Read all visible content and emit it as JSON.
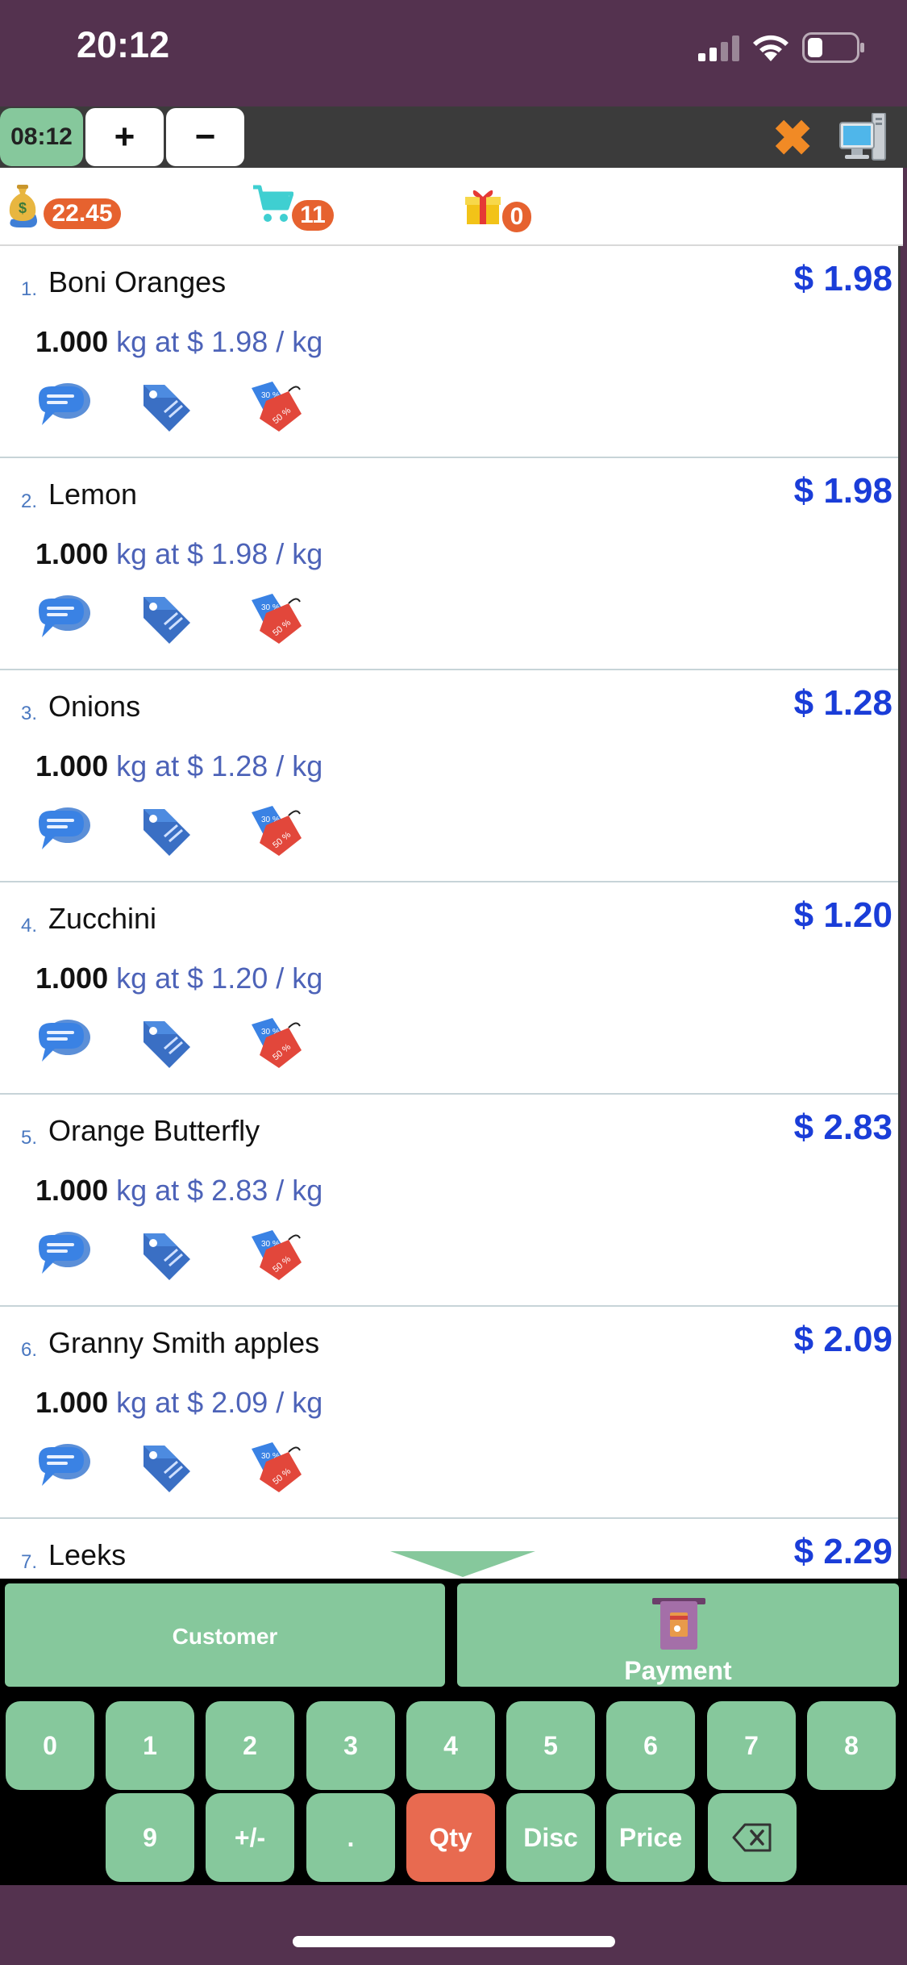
{
  "status_bar": {
    "time": "20:12"
  },
  "toolbar": {
    "clock": "08:12",
    "add_label": "+",
    "remove_label": "−",
    "close_label": "✖"
  },
  "summary": {
    "total": "22.45",
    "cart_count": "11",
    "gift_count": "0"
  },
  "order_lines": [
    {
      "index": "1.",
      "name": "Boni Oranges",
      "price": "$ 1.98",
      "qty": "1.000",
      "unit_text": "kg at $ 1.98 / kg"
    },
    {
      "index": "2.",
      "name": "Lemon",
      "price": "$ 1.98",
      "qty": "1.000",
      "unit_text": "kg at $ 1.98 / kg"
    },
    {
      "index": "3.",
      "name": "Onions",
      "price": "$ 1.28",
      "qty": "1.000",
      "unit_text": "kg at $ 1.28 / kg"
    },
    {
      "index": "4.",
      "name": "Zucchini",
      "price": "$ 1.20",
      "qty": "1.000",
      "unit_text": "kg at $ 1.20 / kg"
    },
    {
      "index": "5.",
      "name": "Orange Butterfly",
      "price": "$ 2.83",
      "qty": "1.000",
      "unit_text": "kg at $ 2.83 / kg"
    },
    {
      "index": "6.",
      "name": "Granny Smith apples",
      "price": "$ 2.09",
      "qty": "1.000",
      "unit_text": "kg at $ 2.09 / kg"
    },
    {
      "index": "7.",
      "name": "Leeks",
      "price": "$ 2.29",
      "qty": "",
      "unit_text": ""
    }
  ],
  "line_icons": [
    "note-icon",
    "tag-icon",
    "discount-tag-icon"
  ],
  "actions": {
    "customer_label": "Customer",
    "payment_label": "Payment"
  },
  "numpad": {
    "row1": [
      "0",
      "1",
      "2",
      "3",
      "4",
      "5",
      "6",
      "7",
      "8"
    ],
    "row2": [
      "9",
      "+/-",
      ".",
      "Qty",
      "Disc",
      "Price"
    ],
    "active_mode": "Qty"
  },
  "colors": {
    "header_bg": "#54324f",
    "key_green": "#86c89c",
    "active_key": "#e86a50",
    "price_blue": "#1a3dd8",
    "badge_orange": "#e6622f"
  }
}
